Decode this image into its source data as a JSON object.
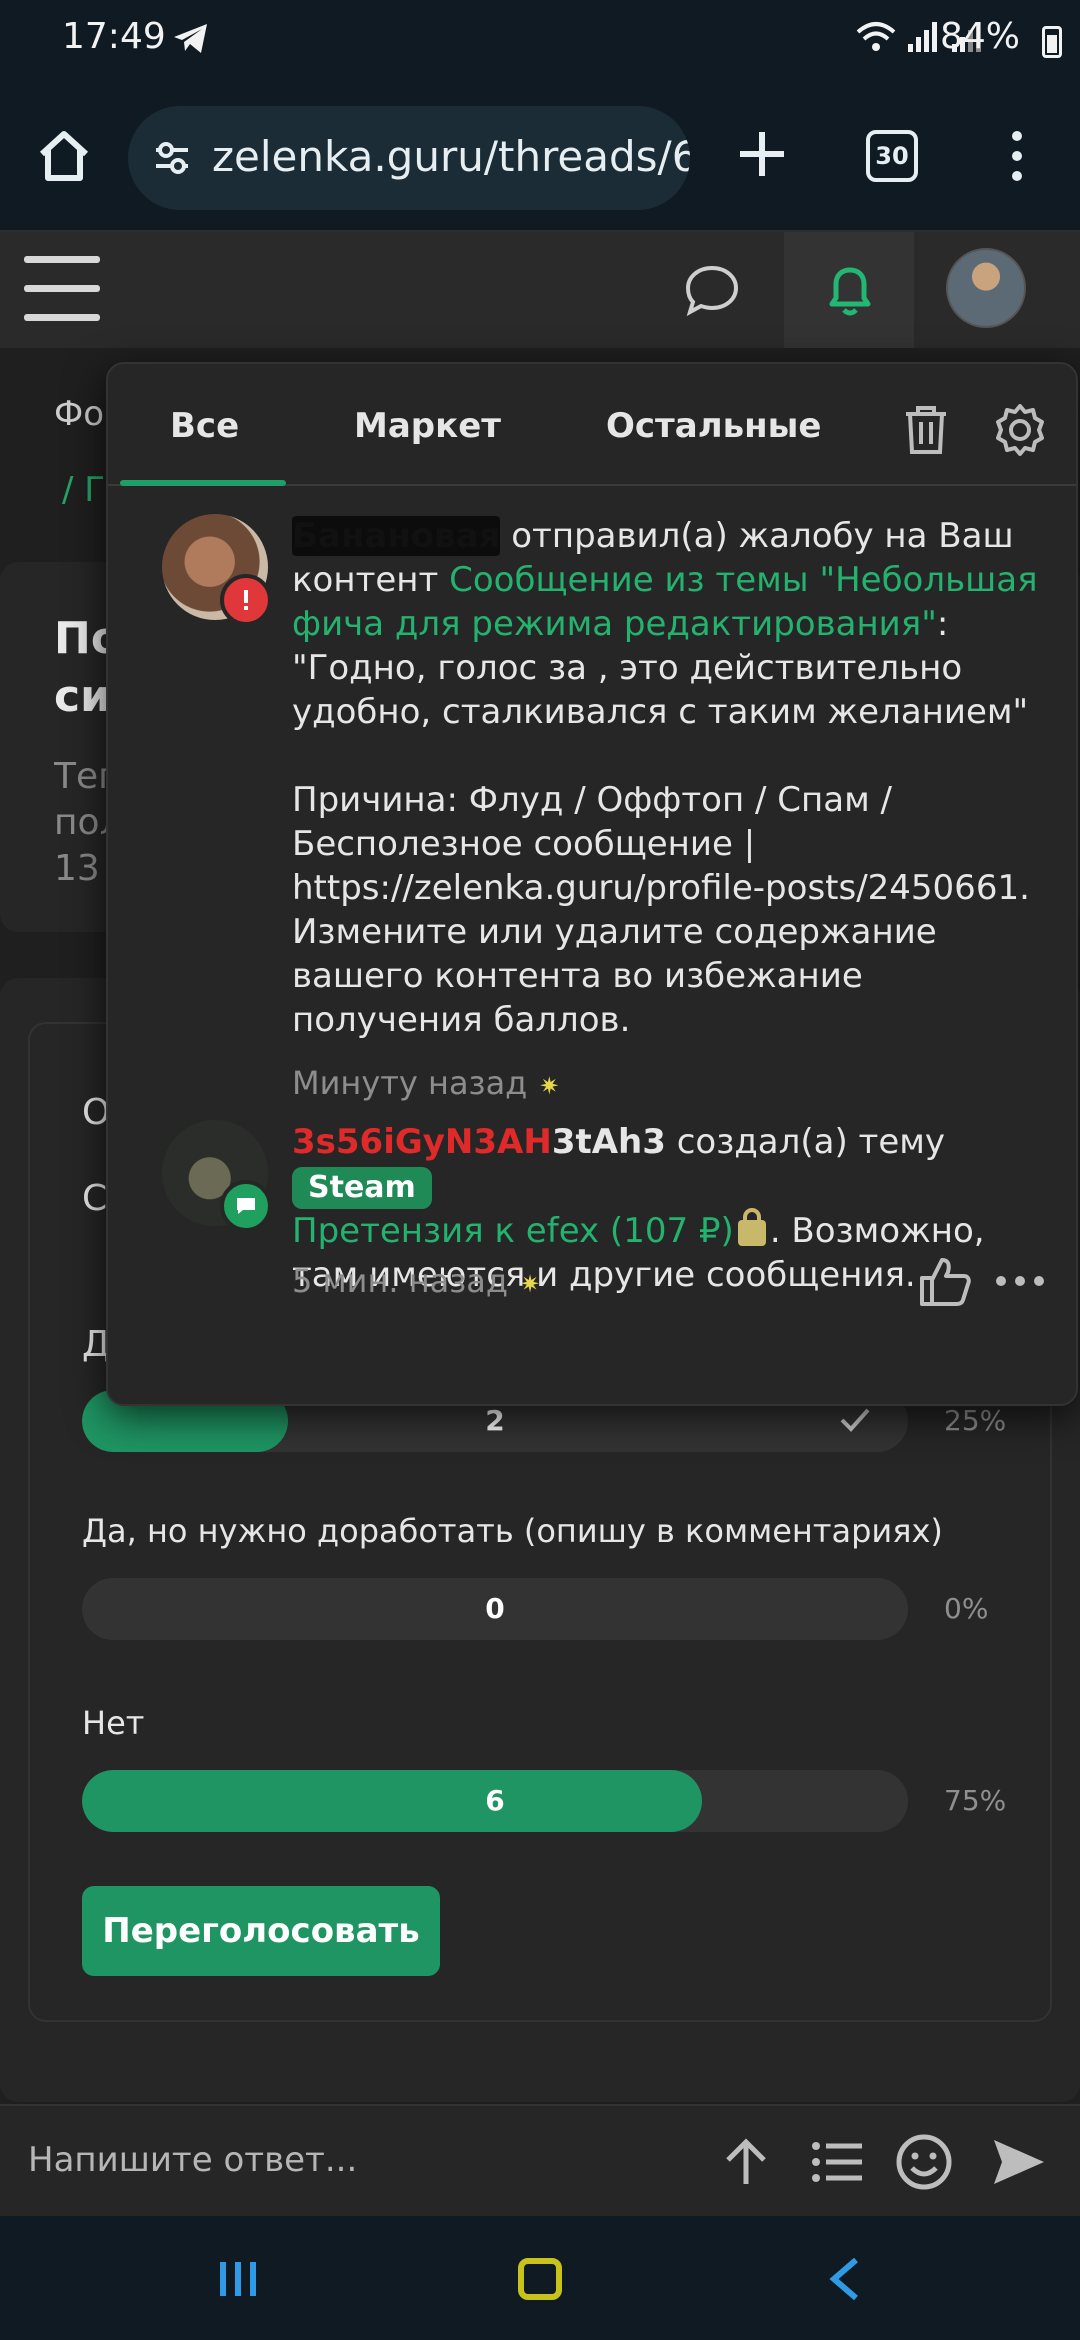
{
  "status_bar": {
    "time": "17:49",
    "battery": "84%"
  },
  "browser": {
    "url": "zelenka.guru/threads/6",
    "tab_count": "30"
  },
  "page": {
    "breadcrumb_1": "Фо",
    "breadcrumb_2": "/ Г",
    "thread_title": "По си",
    "thread_meta": "Тег пол 13"
  },
  "poll": {
    "question_line1": "О",
    "question_line2": "С",
    "question_line3": "Д",
    "options": [
      {
        "label": "",
        "count": "2",
        "percent": "25%",
        "fraction": 0.25
      },
      {
        "label": "Да, но нужно доработать (опишу в комментариях)",
        "count": "0",
        "percent": "0%",
        "fraction": 0.0
      },
      {
        "label": "Нет",
        "count": "6",
        "percent": "75%",
        "fraction": 0.75
      }
    ],
    "revote_label": "Переголосовать"
  },
  "notifications": {
    "tabs": [
      "Все",
      "Маркет",
      "Остальные"
    ],
    "items": [
      {
        "user": "Банановая",
        "action": " отправил(а) жалобу на Ваш контент ",
        "link": "Сообщение из темы \"Небольшая фича для режима редактирования\"",
        "after_link": ":",
        "quote": "\"Годно, голос за , это действительно удобно, сталкивался с таким желанием\"",
        "reason": "Причина: Флуд / Оффтоп / Спам / Бесполезное сообщение | https://zelenka.guru/profile-posts/2450661. Измените или удалите содержание вашего контента во избежание получения баллов.",
        "time": "Минуту назад"
      },
      {
        "user_red": "3s56iGyN3AH",
        "user_white": "3tAh3",
        "action": " создал(а) тему ",
        "tag": "Steam",
        "link": "Претензия к efex (107 ₽)",
        "after_link": ". Возможно, там имеются и другие сообщения.",
        "time": "5 мин. назад"
      }
    ]
  },
  "reply": {
    "placeholder": "Напишите ответ..."
  },
  "colors": {
    "accent": "#1f9563",
    "link": "#24b26f",
    "danger": "#e0373a",
    "background": "#1f1f1f"
  }
}
